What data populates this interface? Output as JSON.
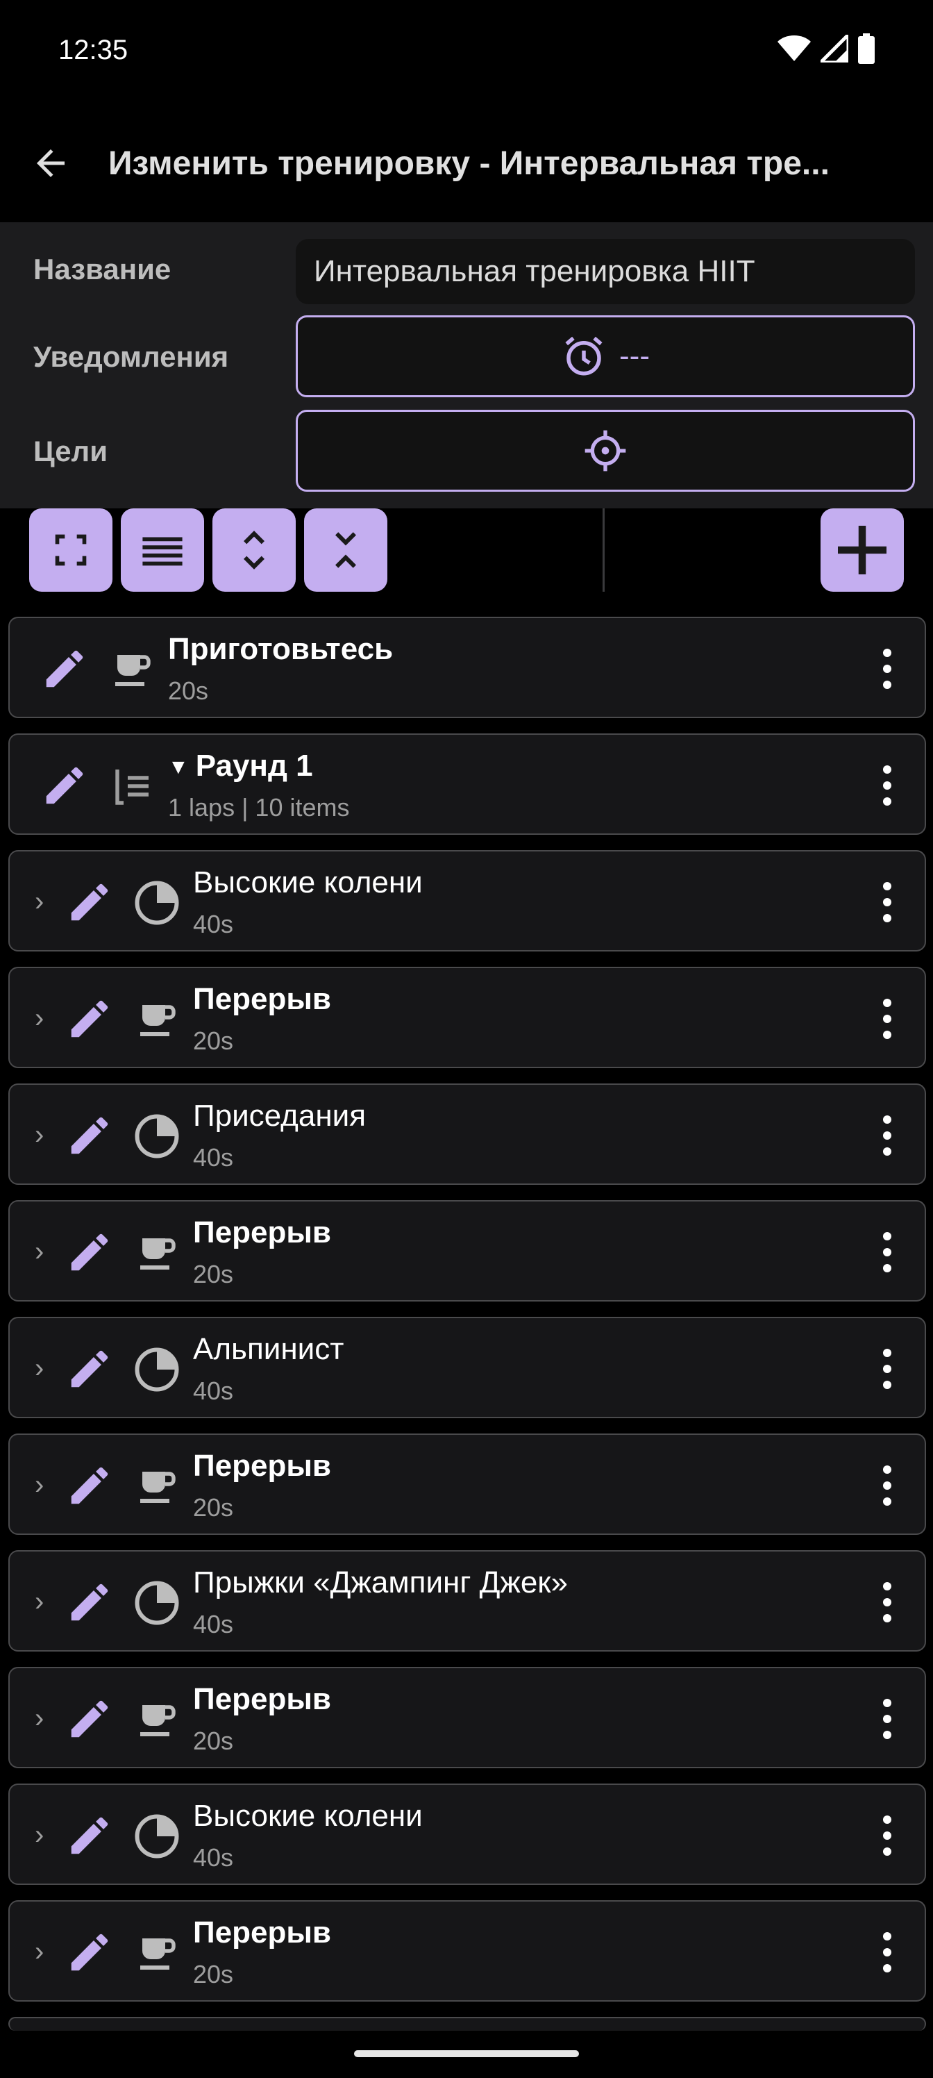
{
  "status": {
    "time": "12:35"
  },
  "header": {
    "title": "Изменить тренировку - Интервальная тре..."
  },
  "form": {
    "name_label": "Название",
    "name_value": "Интервальная тренировка HIIT",
    "notifications_label": "Уведомления",
    "notifications_value": "---",
    "goals_label": "Цели"
  },
  "colors": {
    "accent": "#c4aef0",
    "surface": "#1c1c1e",
    "item": "#161618",
    "border": "#4a4a4c"
  },
  "items": [
    {
      "title": "Приготовьтесь",
      "sub": "20s",
      "kind": "rest",
      "indent": false
    },
    {
      "title": "Раунд 1",
      "sub": "1 laps | 10 items",
      "kind": "set",
      "indent": false
    },
    {
      "title": "Высокие колени",
      "sub": "40s",
      "kind": "exercise",
      "indent": true
    },
    {
      "title": "Перерыв",
      "sub": "20s",
      "kind": "rest",
      "indent": true
    },
    {
      "title": "Приседания",
      "sub": "40s",
      "kind": "exercise",
      "indent": true
    },
    {
      "title": "Перерыв",
      "sub": "20s",
      "kind": "rest",
      "indent": true
    },
    {
      "title": "Альпинист",
      "sub": "40s",
      "kind": "exercise",
      "indent": true
    },
    {
      "title": "Перерыв",
      "sub": "20s",
      "kind": "rest",
      "indent": true
    },
    {
      "title": "Прыжки «Джампинг Джек»",
      "sub": "40s",
      "kind": "exercise",
      "indent": true
    },
    {
      "title": "Перерыв",
      "sub": "20s",
      "kind": "rest",
      "indent": true
    },
    {
      "title": "Высокие колени",
      "sub": "40s",
      "kind": "exercise",
      "indent": true
    },
    {
      "title": "Перерыв",
      "sub": "20s",
      "kind": "rest",
      "indent": true
    }
  ]
}
